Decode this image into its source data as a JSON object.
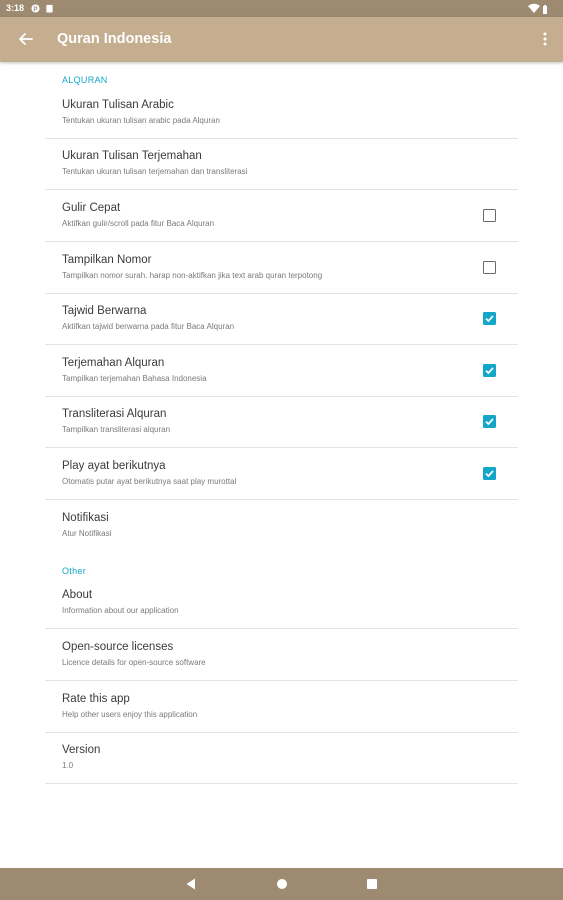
{
  "status_bar": {
    "time": "3:18",
    "icons": [
      "notification-icon",
      "clipboard-icon",
      "wifi-icon",
      "battery-icon"
    ]
  },
  "app_bar": {
    "title": "Quran Indonesia",
    "back_icon": "arrow-left-icon",
    "menu_icon": "more-vertical-icon"
  },
  "sections": {
    "alquran": {
      "header": "ALQURAN",
      "items": [
        {
          "title": "Ukuran Tulisan Arabic",
          "summary": "Tentukan ukuran tulisan arabic pada Alquran"
        },
        {
          "title": "Ukuran Tulisan Terjemahan",
          "summary": "Tentukan ukuran tulisan terjemahan dan transliterasi"
        },
        {
          "title": "Gulir Cepat",
          "summary": "Aktifkan gulir/scroll pada fitur Baca Alquran",
          "checked": false
        },
        {
          "title": "Tampilkan Nomor",
          "summary": "Tampilkan nomor surah. harap non-aktifkan jika text arab quran terpotong",
          "checked": false
        },
        {
          "title": "Tajwid Berwarna",
          "summary": "Aktifkan tajwid berwarna pada fitur Baca Alquran",
          "checked": true
        },
        {
          "title": "Terjemahan Alquran",
          "summary": "Tampilkan terjemahan Bahasa Indonesia",
          "checked": true
        },
        {
          "title": "Transliterasi Alquran",
          "summary": "Tampilkan transliterasi alquran",
          "checked": true
        },
        {
          "title": "Play ayat berikutnya",
          "summary": "Otomatis putar ayat berikutnya saat play murottal",
          "checked": true
        },
        {
          "title": "Notifikasi",
          "summary": "Atur Notifikasi"
        }
      ]
    },
    "other": {
      "header": "Other",
      "items": [
        {
          "title": "About",
          "summary": "Information about our application"
        },
        {
          "title": "Open-source licenses",
          "summary": "Licence details for open-source software"
        },
        {
          "title": "Rate this app",
          "summary": "Help other users enjoy this application"
        },
        {
          "title": "Version",
          "summary": "1.0"
        }
      ]
    }
  },
  "nav_bar": {
    "icons": [
      "back-triangle-icon",
      "home-circle-icon",
      "recents-square-icon"
    ]
  },
  "colors": {
    "app_bar": "#c5ad90",
    "status_bar": "#9d8a71",
    "accent": "#14a6c9"
  }
}
